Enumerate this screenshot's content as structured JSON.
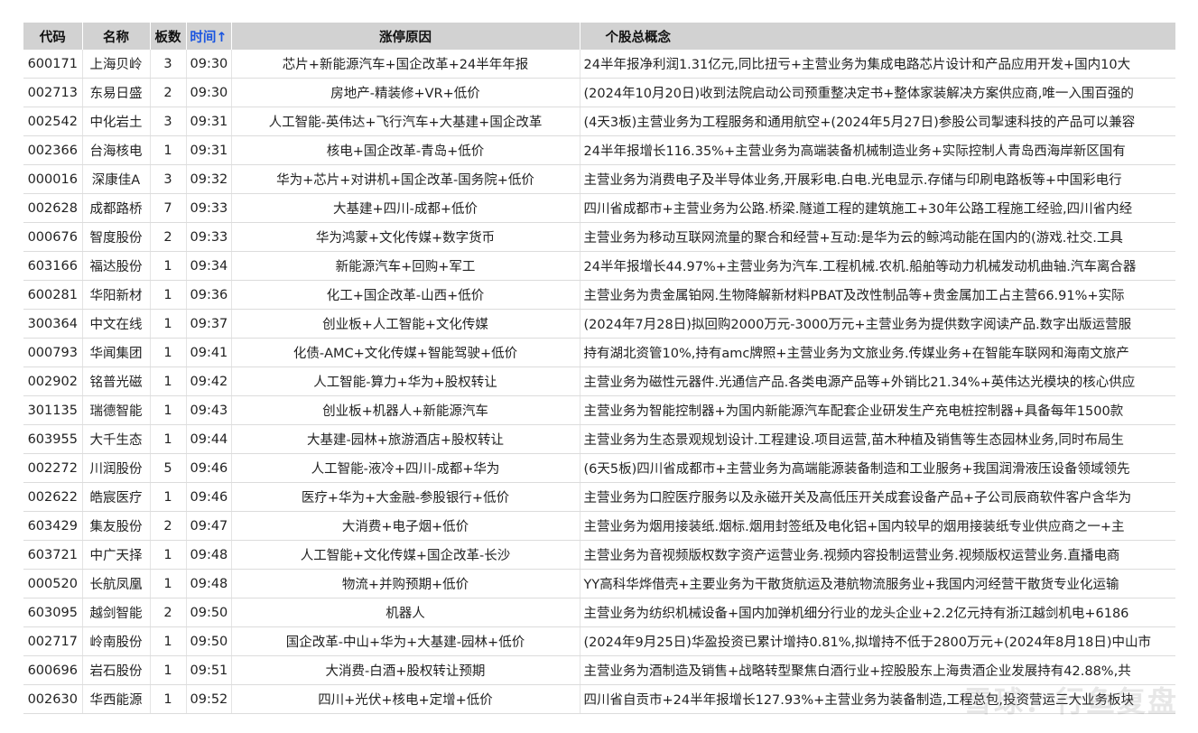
{
  "columns": [
    "代码",
    "名称",
    "板数",
    "时间↑",
    "涨停原因",
    "个股总概念"
  ],
  "rows": [
    [
      "600171",
      "上海贝岭",
      "3",
      "09:30",
      "芯片+新能源汽车+国企改革+24半年年报",
      "24半年报净利润1.31亿元,同比扭亏+主营业务为集成电路芯片设计和产品应用开发+国内10大"
    ],
    [
      "002713",
      "东易日盛",
      "2",
      "09:30",
      "房地产-精装修+VR+低价",
      "(2024年10月20日)收到法院启动公司预重整决定书+整体家装解决方案供应商,唯一入围百强的"
    ],
    [
      "002542",
      "中化岩土",
      "3",
      "09:31",
      "人工智能-英伟达+飞行汽车+大基建+国企改革",
      "(4天3板)主营业务为工程服务和通用航空+(2024年5月27日)参股公司掣速科技的产品可以兼容"
    ],
    [
      "002366",
      "台海核电",
      "1",
      "09:31",
      "核电+国企改革-青岛+低价",
      "24半年报增长116.35%+主营业务为高端装备机械制造业务+实际控制人青岛西海岸新区国有"
    ],
    [
      "000016",
      "深康佳A",
      "3",
      "09:32",
      "华为+芯片+对讲机+国企改革-国务院+低价",
      "主营业务为消费电子及半导体业务,开展彩电.白电.光电显示.存储与印刷电路板等+中国彩电行"
    ],
    [
      "002628",
      "成都路桥",
      "7",
      "09:33",
      "大基建+四川-成都+低价",
      "四川省成都市+主营业务为公路.桥梁.隧道工程的建筑施工+30年公路工程施工经验,四川省内经"
    ],
    [
      "000676",
      "智度股份",
      "2",
      "09:33",
      "华为鸿蒙+文化传媒+数字货币",
      "主营业务为移动互联网流量的聚合和经营+互动:是华为云的鲸鸿动能在国内的(游戏.社交.工具"
    ],
    [
      "603166",
      "福达股份",
      "1",
      "09:34",
      "新能源汽车+回购+军工",
      "24半年报增长44.97%+主营业务为汽车.工程机械.农机.船舶等动力机械发动机曲轴.汽车离合器"
    ],
    [
      "600281",
      "华阳新材",
      "1",
      "09:36",
      "化工+国企改革-山西+低价",
      "主营业务为贵金属铂网.生物降解新材料PBAT及改性制品等+贵金属加工占主营66.91%+实际"
    ],
    [
      "300364",
      "中文在线",
      "1",
      "09:37",
      "创业板+人工智能+文化传媒",
      "(2024年7月28日)拟回购2000万元-3000万元+主营业务为提供数字阅读产品.数字出版运营服"
    ],
    [
      "000793",
      "华闻集团",
      "1",
      "09:41",
      "化债-AMC+文化传媒+智能驾驶+低价",
      "持有湖北资管10%,持有amc牌照+主营业务为文旅业务.传媒业务+在智能车联网和海南文旅产"
    ],
    [
      "002902",
      "铭普光磁",
      "1",
      "09:42",
      "人工智能-算力+华为+股权转让",
      "主营业务为磁性元器件.光通信产品.各类电源产品等+外销比21.34%+英伟达光模块的核心供应"
    ],
    [
      "301135",
      "瑞德智能",
      "1",
      "09:43",
      "创业板+机器人+新能源汽车",
      "主营业务为智能控制器+为国内新能源汽车配套企业研发生产充电桩控制器+具备每年1500款"
    ],
    [
      "603955",
      "大千生态",
      "1",
      "09:44",
      "大基建-园林+旅游酒店+股权转让",
      "主营业务为生态景观规划设计.工程建设.项目运营,苗木种植及销售等生态园林业务,同时布局生"
    ],
    [
      "002272",
      "川润股份",
      "5",
      "09:46",
      "人工智能-液冷+四川-成都+华为",
      "(6天5板)四川省成都市+主营业务为高端能源装备制造和工业服务+我国润滑液压设备领域领先"
    ],
    [
      "002622",
      "皓宸医疗",
      "1",
      "09:46",
      "医疗+华为+大金融-参股银行+低价",
      "主营业务为口腔医疗服务以及永磁开关及高低压开关成套设备产品+子公司辰商软件客户含华为"
    ],
    [
      "603429",
      "集友股份",
      "2",
      "09:47",
      "大消费+电子烟+低价",
      "主营业务为烟用接装纸.烟标.烟用封签纸及电化铝+国内较早的烟用接装纸专业供应商之一+主"
    ],
    [
      "603721",
      "中广天择",
      "1",
      "09:48",
      "人工智能+文化传媒+国企改革-长沙",
      "主营业务为音视频版权数字资产运营业务.视频内容投制运营业务.视频版权运营业务.直播电商"
    ],
    [
      "000520",
      "长航凤凰",
      "1",
      "09:48",
      "物流+并购预期+低价",
      "YY高科华烨借壳+主要业务为干散货航运及港航物流服务业+我国内河经营干散货专业化运输"
    ],
    [
      "603095",
      "越剑智能",
      "2",
      "09:50",
      "机器人",
      "主营业务为纺织机械设备+国内加弹机细分行业的龙头企业+2.2亿元持有浙江越剑机电+6186"
    ],
    [
      "002717",
      "岭南股份",
      "1",
      "09:50",
      "国企改革-中山+华为+大基建-园林+低价",
      "(2024年9月25日)华盈投资已累计增持0.81%,拟增持不低于2800万元+(2024年8月18日)中山市"
    ],
    [
      "600696",
      "岩石股份",
      "1",
      "09:51",
      "大消费-白酒+股权转让预期",
      "主营业务为酒制造及销售+战略转型聚焦白酒行业+控股股东上海贵酒企业发展持有42.88%,共"
    ],
    [
      "002630",
      "华西能源",
      "1",
      "09:52",
      "四川+光伏+核电+定增+低价",
      "四川省自贡市+24半年报增长127.93%+主营业务为装备制造,工程总包,投资营运三大业务板块"
    ]
  ],
  "watermark": "雪球：行鱼复盘"
}
